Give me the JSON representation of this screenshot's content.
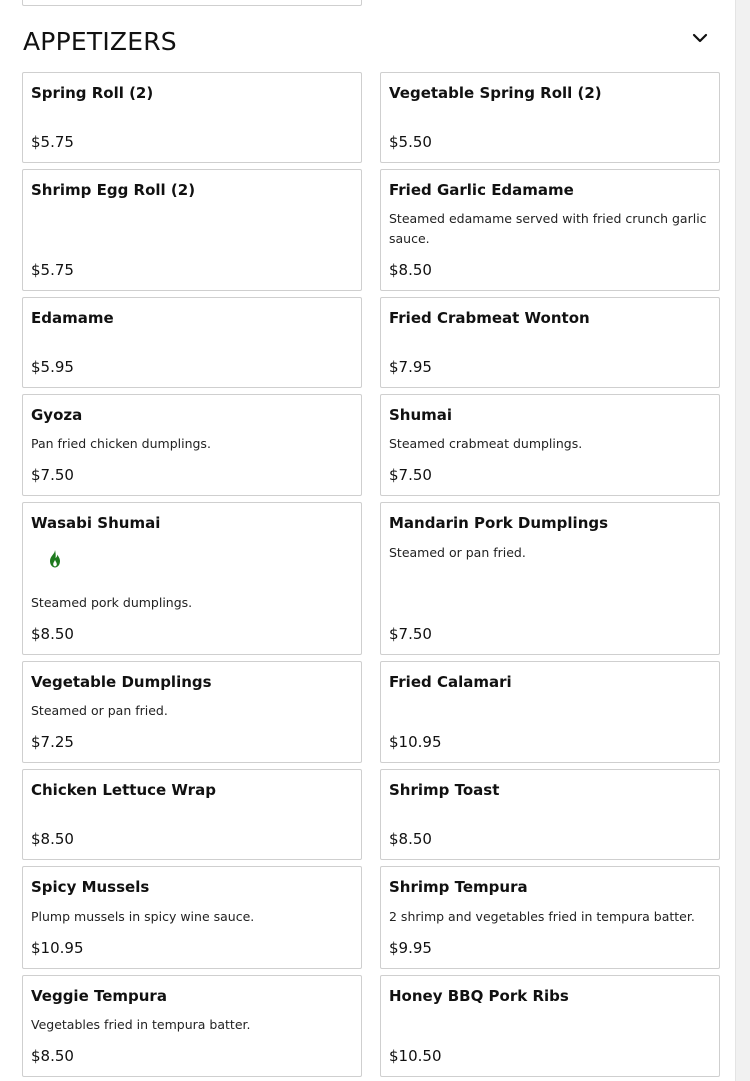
{
  "section": {
    "title": "APPETIZERS",
    "toggle_icon": "chevron-down-icon"
  },
  "colors": {
    "card_border": "#cfcfcf",
    "text": "#111111",
    "spicy_icon": "#1e7a1e"
  },
  "items": [
    {
      "name": "Spring Roll (2)",
      "desc": "",
      "price": "$5.75"
    },
    {
      "name": "Vegetable Spring Roll (2)",
      "desc": "",
      "price": "$5.50"
    },
    {
      "name": "Shrimp Egg Roll (2)",
      "desc": "",
      "price": "$5.75"
    },
    {
      "name": "Fried Garlic Edamame",
      "desc": "Steamed edamame served with fried crunch garlic sauce.",
      "price": "$8.50"
    },
    {
      "name": "Edamame",
      "desc": "",
      "price": "$5.95"
    },
    {
      "name": "Fried Crabmeat Wonton",
      "desc": "",
      "price": "$7.95"
    },
    {
      "name": "Gyoza",
      "desc": "Pan fried chicken dumplings.",
      "price": "$7.50"
    },
    {
      "name": "Shumai",
      "desc": "Steamed crabmeat dumplings.",
      "price": "$7.50"
    },
    {
      "name": "Wasabi Shumai",
      "desc": "Steamed pork dumplings.",
      "price": "$8.50",
      "icon": "spicy-flame-icon"
    },
    {
      "name": "Mandarin Pork Dumplings",
      "desc": "Steamed or pan fried.",
      "price": "$7.50"
    },
    {
      "name": "Vegetable Dumplings",
      "desc": "Steamed or pan fried.",
      "price": "$7.25"
    },
    {
      "name": "Fried Calamari",
      "desc": "",
      "price": "$10.95"
    },
    {
      "name": "Chicken Lettuce Wrap",
      "desc": "",
      "price": "$8.50"
    },
    {
      "name": "Shrimp Toast",
      "desc": "",
      "price": "$8.50"
    },
    {
      "name": "Spicy Mussels",
      "desc": "Plump mussels in spicy wine sauce.",
      "price": "$10.95"
    },
    {
      "name": "Shrimp Tempura",
      "desc": "2 shrimp and vegetables fried in tempura batter.",
      "price": "$9.95"
    },
    {
      "name": "Veggie Tempura",
      "desc": "Vegetables fried in tempura batter.",
      "price": "$8.50"
    },
    {
      "name": "Honey BBQ Pork Ribs",
      "desc": "",
      "price": "$10.50"
    }
  ]
}
